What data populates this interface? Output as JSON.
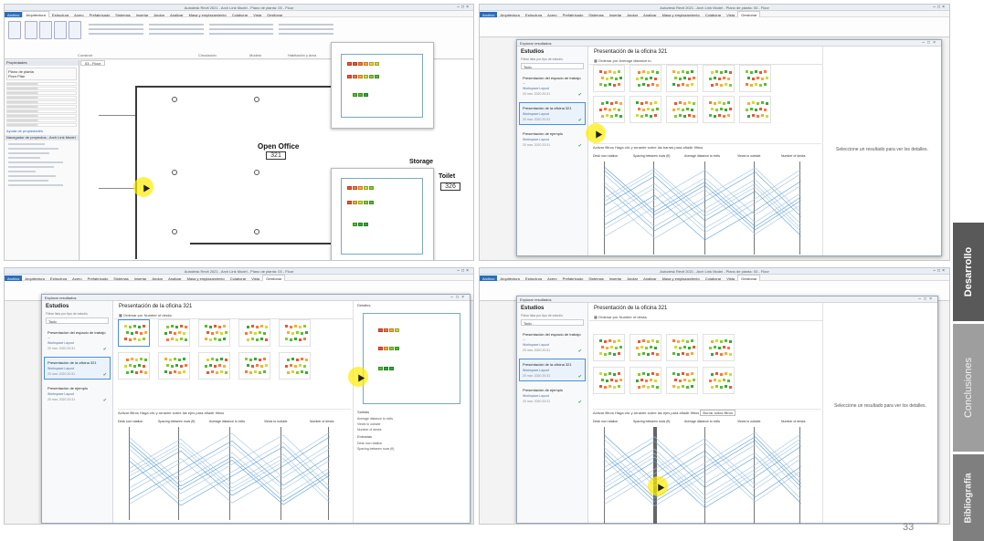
{
  "sidebar": {
    "sections": [
      {
        "label": "Desarrollo",
        "active": true
      },
      {
        "label": "Conclusiones",
        "active": false
      },
      {
        "label": "Bibliografía",
        "active": false
      }
    ]
  },
  "page_number": "33",
  "screenshots": {
    "revit": {
      "window_title": "Autodesk Revit 2021 - Arch Link Model - Plano de planta: 03 - Floor",
      "ribbon_tabs": [
        "Archivo",
        "Arquitectura",
        "Estructura",
        "Acero",
        "Prefabricado",
        "Sistemas",
        "Insertar",
        "Anotar",
        "Analizar",
        "Masa y emplazamiento",
        "Colaborar",
        "Vista",
        "Gestionar",
        "Complementos",
        "Modificar"
      ],
      "ribbon_groups": [
        "Construir",
        "Circulación",
        "Modelo",
        "Habitación y área"
      ],
      "properties_title": "Propiedades",
      "view_type": "Plano de planta\nFloor Plan",
      "properties_link": "Ayuda de propiedades",
      "browser_title": "Navegador de proyectos - Arch Link Model",
      "view_tab": "03 - Floor",
      "room_label": "Open Office",
      "room_number": "321",
      "storage_label": "Storage",
      "toilet_label": "Toilet",
      "toilet_number": "326"
    },
    "explore": {
      "dialog_title": "Explorar resultados",
      "studies_heading": "Estudios",
      "filter_label": "Filtrar lista por tipo de estudio",
      "filter_value": "Todo",
      "studies": [
        {
          "title": "Presentación del espacio de trabajo ...",
          "type": "Workspace Layout",
          "date": "20 mar. 2020 20:31"
        },
        {
          "title": "Presentación de la oficina 321",
          "type": "Workspace Layout",
          "date": "20 mar. 2020 20:31"
        },
        {
          "title": "Presentación de ejemplo",
          "type": "Workspace Layout",
          "date": "20 mar. 2020 20:31"
        }
      ],
      "results_title": "Presentación de la oficina 321",
      "sort_label": "Ordenar por",
      "sort_value_2": "Average distance to",
      "sort_value_3": "Number of desks",
      "view_buttons": [
        "Diagramas",
        "Detalles"
      ],
      "filter_bar_2": "Activar filtros  Haga clic y arrastre sobre las barras para añadir filtros",
      "filter_bar_3": "Activar filtros  Haga clic y arrastre sobre las ejes para añadir filtros",
      "filter_bar_4": "Activar filtros  Haga clic y arrastre sobre las ejes para añadir filtros",
      "clear_filters": "Borrar todos filtros",
      "axes": [
        "Desk row rotation",
        "Spacing between rows (ft)",
        "Average distance to exits",
        "Views to outside",
        "Number of desks"
      ],
      "details_message": "Seleccione un resultado para ver los detalles.",
      "details_heading": "Detalles",
      "details_outputs": "Salidas",
      "details_output_rows": [
        "Average distance to exits",
        "Views to outside",
        "Number of desks"
      ],
      "details_input_heading": "Entradas",
      "details_input_rows": [
        "Desk row rotation",
        "Spacing between rows (ft)"
      ]
    }
  },
  "colors": {
    "sidebar_active": "#595959",
    "sidebar_inactive": "#9e9e9e",
    "sidebar_bib": "#7f7f7f",
    "accent_blue": "#2a6ebb",
    "cursor_highlight": "#ffec00"
  }
}
